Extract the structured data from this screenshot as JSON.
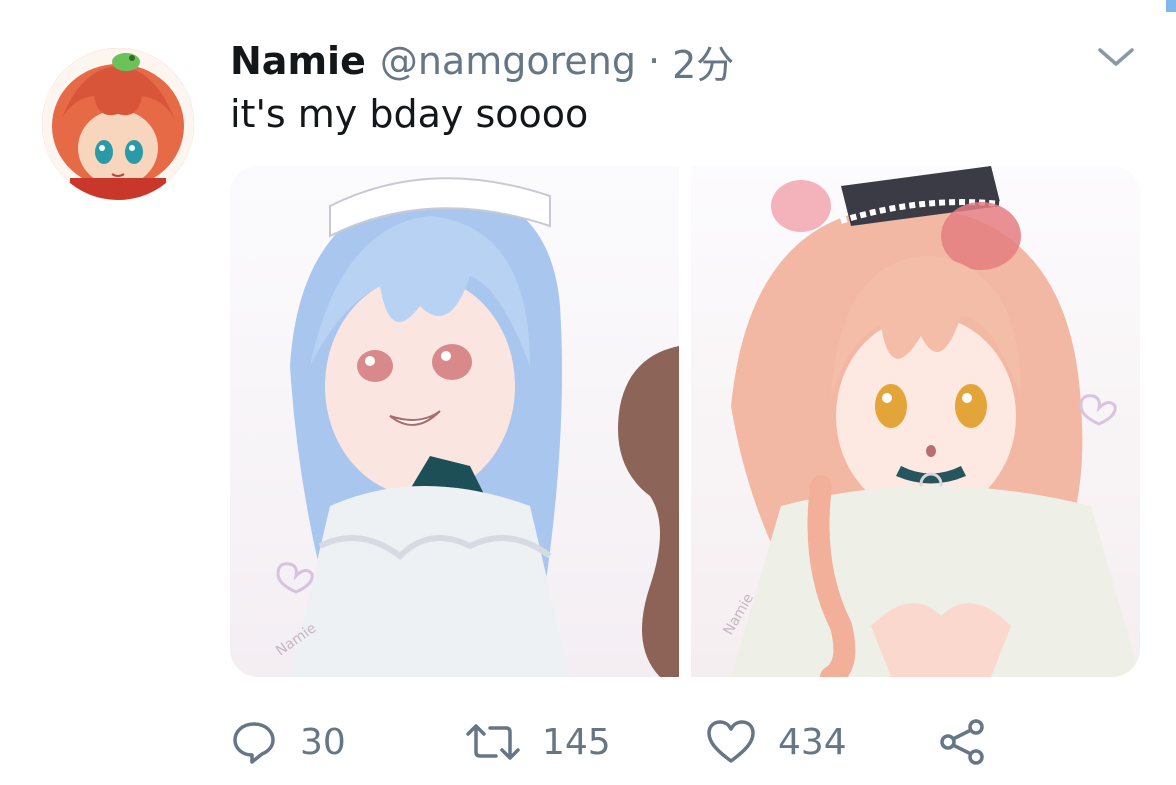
{
  "tweet": {
    "display_name": "Namie",
    "handle": "@namgoreng",
    "separator": "·",
    "time": "2分",
    "text": "it's my bday soooo"
  },
  "actions": {
    "reply_count": "30",
    "retweet_count": "145",
    "like_count": "434"
  },
  "media": {
    "left_watermark": "Namie",
    "right_watermark": "Namie"
  },
  "colors": {
    "primary_text": "#14171a",
    "secondary_text": "#657786",
    "icon": "#657786"
  }
}
